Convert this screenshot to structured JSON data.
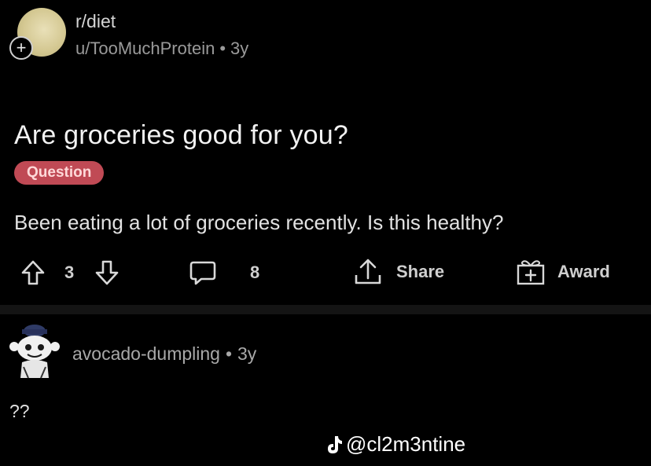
{
  "post": {
    "subreddit": "r/diet",
    "author": "u/TooMuchProtein",
    "separator": "•",
    "age": "3y",
    "title": "Are groceries good for you?",
    "flair": "Question",
    "body": "Been eating a lot of groceries recently. Is this healthy?"
  },
  "actions": {
    "upvote_icon": "arrow-up-icon",
    "vote_count": "3",
    "downvote_icon": "arrow-down-icon",
    "comment_icon": "comment-bubble-icon",
    "comment_count": "8",
    "share_icon": "share-icon",
    "share_label": "Share",
    "award_icon": "gift-icon",
    "award_label": "Award"
  },
  "comment": {
    "author": "avocado-dumpling",
    "separator": "•",
    "age": "3y",
    "text": "??"
  },
  "watermark": {
    "text": "@cl2m3ntine",
    "icon": "tiktok-icon"
  },
  "colors": {
    "background": "#000000",
    "flair_bg": "#c04a55",
    "flair_text": "#ffd9d9"
  }
}
